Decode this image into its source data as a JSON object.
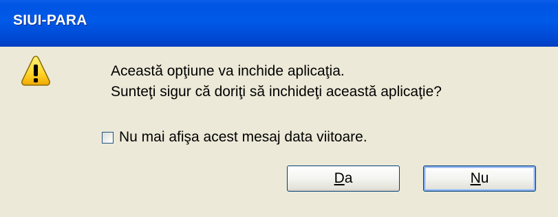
{
  "window": {
    "title": "SIUI-PARA"
  },
  "dialog": {
    "icon": "warning-icon",
    "message_line1": "Această opţiune va inchide aplicaţia.",
    "message_line2": "Sunteţi sigur că doriţi să inchideţi această aplicaţie?",
    "checkbox_label": "Nu mai afişa acest mesaj data viitoare.",
    "checkbox_checked": false
  },
  "buttons": {
    "yes_mnemonic": "D",
    "yes_rest": "a",
    "no_mnemonic": "N",
    "no_rest": "u"
  },
  "colors": {
    "titlebar": "#0054e3",
    "dialog_background": "#ece9d8",
    "button_border": "#003c74",
    "warning_yellow": "#ffd42a"
  }
}
